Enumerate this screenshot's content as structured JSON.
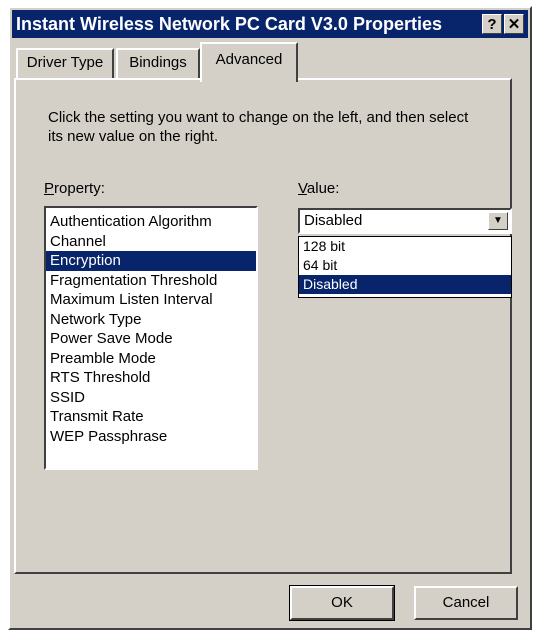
{
  "window": {
    "title": "Instant Wireless Network PC Card V3.0 Properties",
    "help_label": "?",
    "close_label": "✕"
  },
  "tabs": [
    {
      "label": "Driver Type",
      "active": false
    },
    {
      "label": "Bindings",
      "active": false
    },
    {
      "label": "Advanced",
      "active": true
    }
  ],
  "instructions": "Click the setting you want to change on the left, and then select its new value on the right.",
  "property": {
    "label_prefix": "P",
    "label_rest": "roperty:",
    "items": [
      "Authentication Algorithm",
      "Channel",
      "Encryption",
      "Fragmentation Threshold",
      "Maximum Listen Interval",
      "Network Type",
      "Power Save Mode",
      "Preamble Mode",
      "RTS Threshold",
      "SSID",
      "Transmit Rate",
      "WEP Passphrase"
    ],
    "selected": "Encryption"
  },
  "value": {
    "label_prefix": "V",
    "label_rest": "alue:",
    "current": "Disabled",
    "dropdown_icon": "chevron-down-icon",
    "options": [
      "128 bit",
      "64 bit",
      "Disabled"
    ],
    "selected": "Disabled"
  },
  "buttons": {
    "ok": "OK",
    "cancel": "Cancel"
  },
  "colors": {
    "titlebar": "#08246b",
    "face": "#d4d0c8",
    "highlight": "#08246b"
  }
}
